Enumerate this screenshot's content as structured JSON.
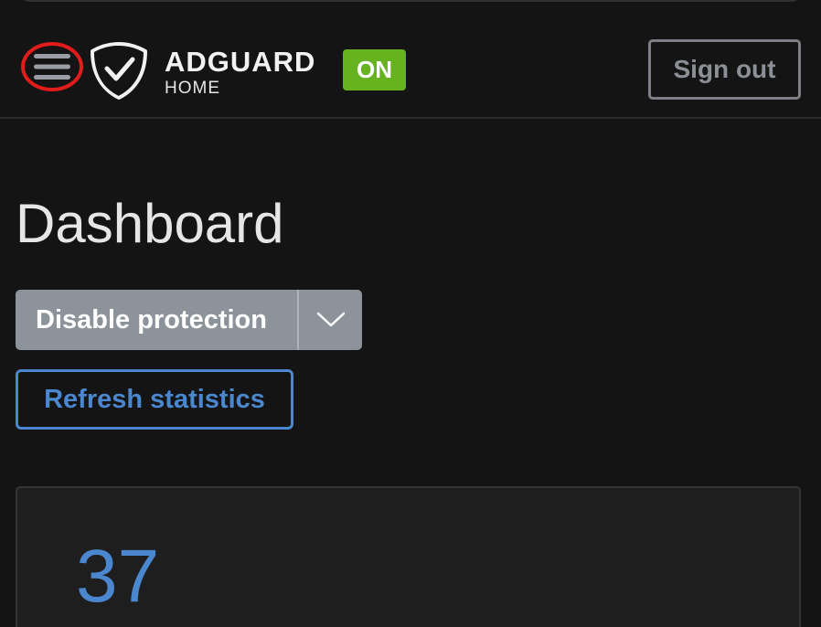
{
  "header": {
    "brand_name": "ADGUARD",
    "brand_sub": "HOME",
    "status_badge": "ON",
    "signout_label": "Sign out"
  },
  "dashboard": {
    "title": "Dashboard",
    "disable_label": "Disable protection",
    "refresh_label": "Refresh statistics",
    "stat_value": "37"
  },
  "colors": {
    "accent_blue": "#4a87cf",
    "badge_green": "#67b21f",
    "highlight_red": "#e21b1b"
  },
  "icons": [
    "menu-icon",
    "adguard-shield-logo",
    "chevron-down-icon"
  ]
}
